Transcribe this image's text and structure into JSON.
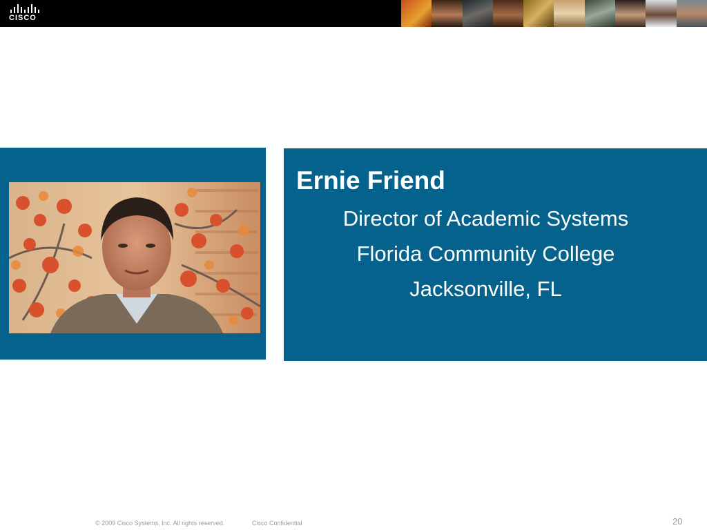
{
  "brand": {
    "logo_text": "CISCO",
    "header_color": "#000000",
    "panel_color": "#04628c"
  },
  "header_photo_strip": {
    "tiles": [
      "photo-collage-1",
      "photo-collage-2",
      "photo-collage-3",
      "photo-collage-4",
      "photo-collage-5",
      "photo-collage-6",
      "photo-collage-7",
      "photo-collage-8",
      "photo-collage-9",
      "photo-collage-10"
    ]
  },
  "profile": {
    "name": "Ernie Friend",
    "title": "Director of Academic Systems",
    "organization": "Florida Community College",
    "location": "Jacksonville, FL",
    "photo": "portrait-photo"
  },
  "footer": {
    "copyright": "© 2009 Cisco Systems, Inc. All rights reserved.",
    "confidential": "Cisco Confidential",
    "page_number": "20"
  }
}
